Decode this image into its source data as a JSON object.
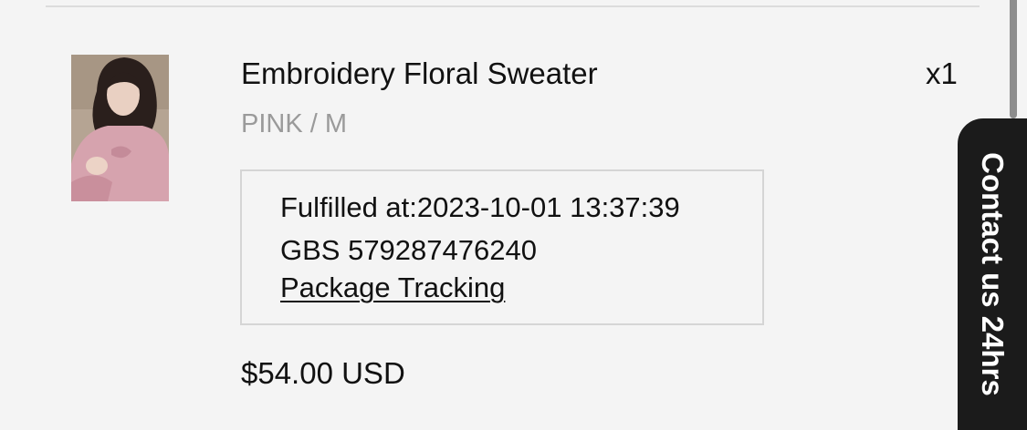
{
  "order_item": {
    "title": "Embroidery Floral Sweater",
    "quantity": "x1",
    "variant": "PINK / M",
    "fulfillment": {
      "fulfilled_at": "Fulfilled at:2023-10-01 13:37:39",
      "tracking_number": "GBS 579287476240",
      "tracking_link": "Package Tracking"
    },
    "price": "$54.00 USD"
  },
  "contact_tab": {
    "label": "Contact us 24hrs"
  }
}
